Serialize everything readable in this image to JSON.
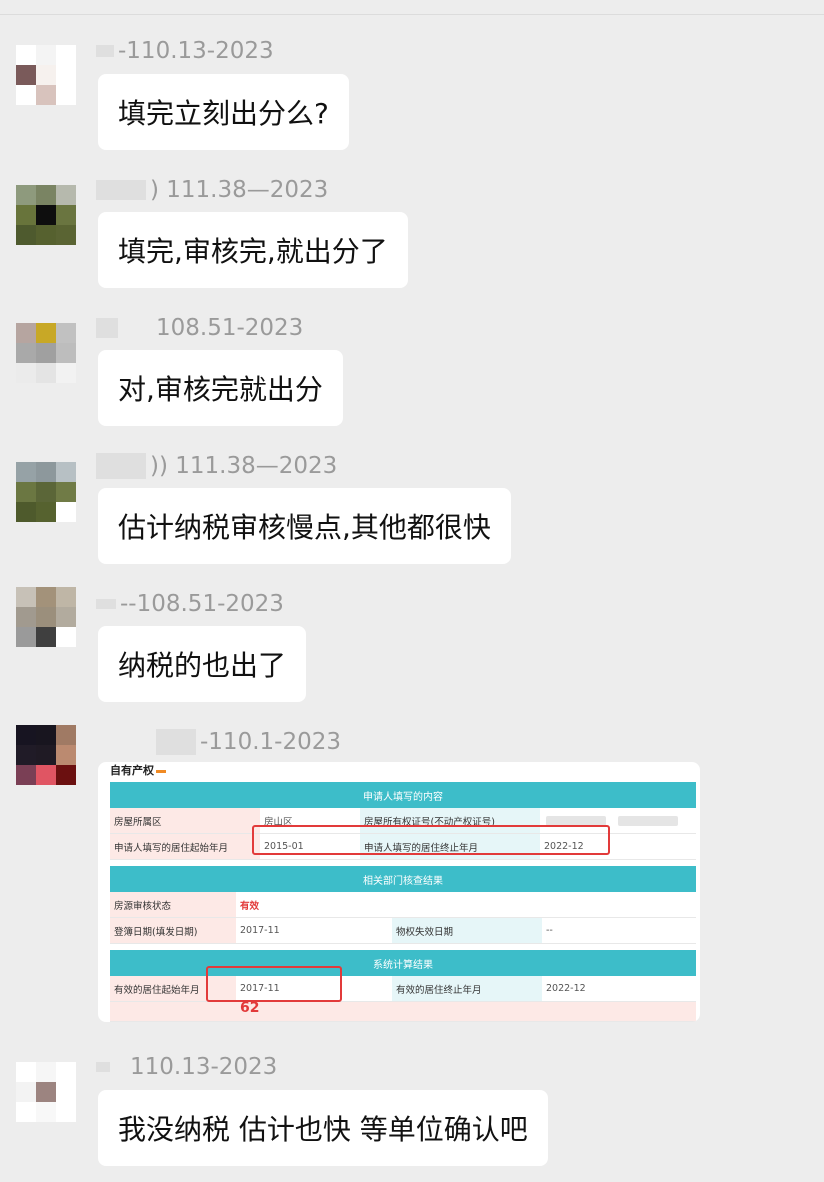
{
  "messages": [
    {
      "sender": "-110.13-2023",
      "text": "填完立刻出分么?"
    },
    {
      "sender": ") 111.38—2023",
      "text": "填完,审核完,就出分了"
    },
    {
      "sender": "108.51-2023",
      "text": "对,审核完就出分"
    },
    {
      "sender": ")) 111.38—2023",
      "text": "估计纳税审核慢点,其他都很快"
    },
    {
      "sender": "--108.51-2023",
      "text": "纳税的也出了"
    },
    {
      "sender": "-110.1-2023"
    },
    {
      "sender": "110.13-2023",
      "text": "我没纳税 估计也快 等单位确认吧"
    }
  ],
  "image_doc": {
    "top_fragment": "自有产权",
    "section1_title": "申请人填写的内容",
    "row1": {
      "l1": "房屋所属区",
      "v1": "房山区",
      "l2": "房屋所有权证号(不动产权证号)",
      "v2": ""
    },
    "row2": {
      "l1": "申请人填写的居住起始年月",
      "v1": "2015-01",
      "l2": "申请人填写的居住终止年月",
      "v2": "2022-12"
    },
    "section2_title": "相关部门核查结果",
    "row3": {
      "l1": "房源审核状态",
      "v1": "有效"
    },
    "row4": {
      "l1": "登簿日期(填发日期)",
      "v1": "2017-11",
      "l2": "物权失效日期",
      "v2": "--"
    },
    "section3_title": "系统计算结果",
    "row5": {
      "l1": "有效的居住起始年月",
      "v1": "2017-11",
      "l2": "有效的居住终止年月",
      "v2": "2022-12"
    },
    "score": "62"
  },
  "colors": {
    "background": "#ededed",
    "bubble": "#ffffff",
    "header_bar": "#3dbdc9",
    "highlight_red": "#e23a3a"
  }
}
